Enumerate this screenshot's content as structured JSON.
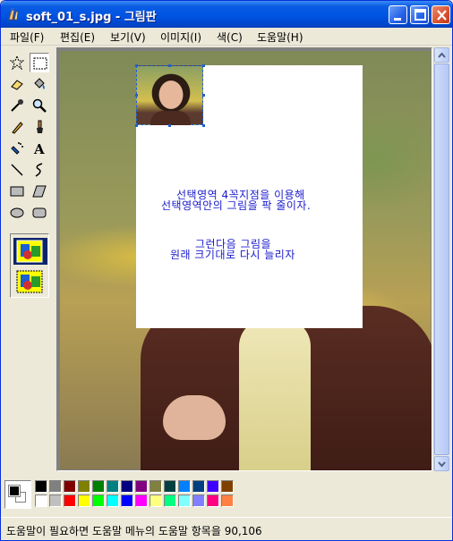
{
  "window": {
    "title": "soft_01_s.jpg - 그림판"
  },
  "titlebar_buttons": {
    "minimize": "minimize-icon",
    "maximize": "maximize-icon",
    "close": "close-icon"
  },
  "menu": {
    "items": [
      {
        "label": "파일(F)"
      },
      {
        "label": "편집(E)"
      },
      {
        "label": "보기(V)"
      },
      {
        "label": "이미지(I)"
      },
      {
        "label": "색(C)"
      },
      {
        "label": "도움말(H)"
      }
    ]
  },
  "tools": [
    "free-form-select-icon",
    "rect-select-icon",
    "eraser-icon",
    "fill-icon",
    "pick-color-icon",
    "magnifier-icon",
    "pencil-icon",
    "brush-icon",
    "airbrush-icon",
    "text-icon",
    "line-icon",
    "curve-icon",
    "rectangle-icon",
    "polygon-icon",
    "ellipse-icon",
    "rounded-rect-icon"
  ],
  "selected_tool": "rect-select-icon",
  "canvas": {
    "note_line1": "선택영역 4꼭지점을 이용해",
    "note_line2": "선택영역안의 그림을 팍 줄이자.",
    "note_line3": "그런다음 그림을",
    "note_line4": "원래 크기대로 다시 늘리자"
  },
  "palette": {
    "foreground": "#000000",
    "background": "#ffffff",
    "row1": [
      "#000000",
      "#808080",
      "#800000",
      "#808000",
      "#008000",
      "#008080",
      "#000080",
      "#800080",
      "#808040",
      "#004040",
      "#0080ff",
      "#004080",
      "#4000ff",
      "#804000"
    ],
    "row2": [
      "#ffffff",
      "#c0c0c0",
      "#ff0000",
      "#ffff00",
      "#00ff00",
      "#00ffff",
      "#0000ff",
      "#ff00ff",
      "#ffff80",
      "#00ff80",
      "#80ffff",
      "#8080ff",
      "#ff0080",
      "#ff8040"
    ]
  },
  "status": {
    "text": "도움말이 필요하면 도움말 메뉴의 도움말 항목을 90,106"
  }
}
